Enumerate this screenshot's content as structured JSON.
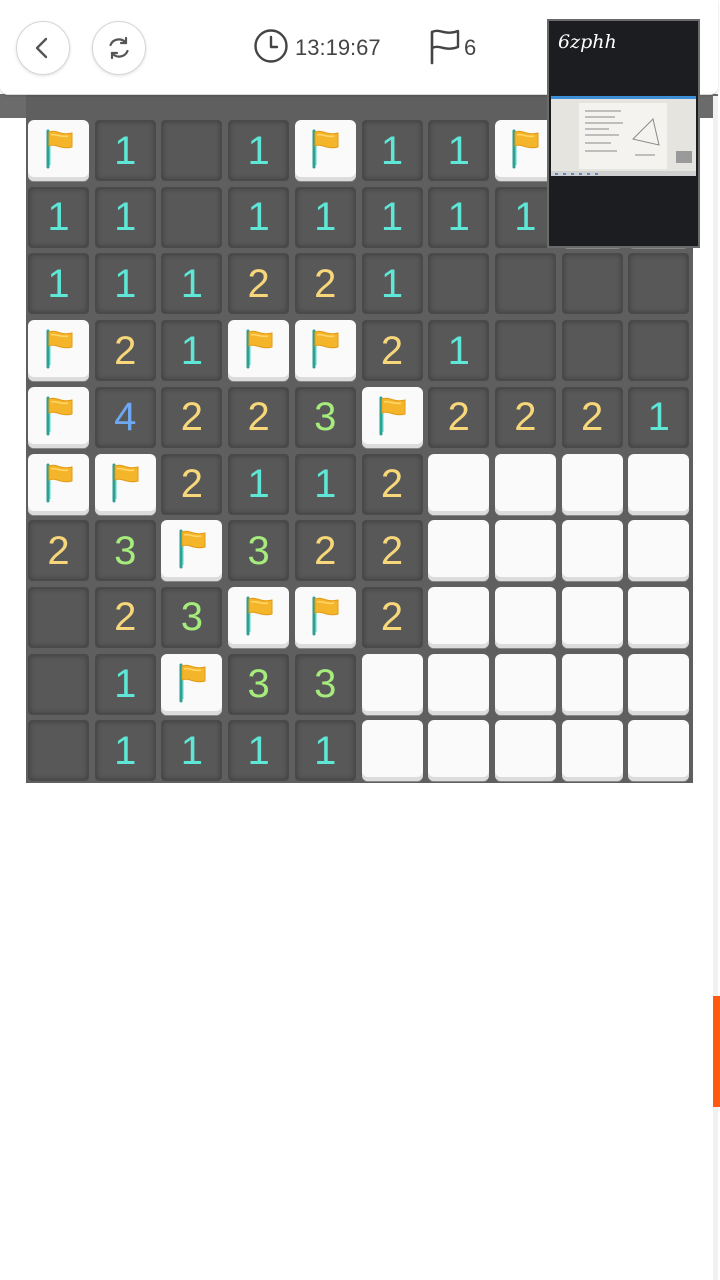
{
  "toolbar": {
    "back_icon": "chevron-left-icon",
    "restart_icon": "refresh-icon",
    "timer": "13:19:67",
    "flags": "6"
  },
  "pip": {
    "label": "6zphh"
  },
  "colors": {
    "number_1": "#5ee6d6",
    "number_2": "#f7d77a",
    "number_3": "#a6ec7c",
    "number_4": "#6ea8f0",
    "flag": "#f5b52a",
    "scroll_thumb": "#ff5a0f"
  },
  "board": {
    "rows": [
      [
        "F",
        "1",
        "",
        "1",
        "F",
        "1",
        "1",
        "F",
        "#",
        "#"
      ],
      [
        "1",
        "1",
        "",
        "1",
        "1",
        "1",
        "1",
        "1",
        "#",
        "#"
      ],
      [
        "1",
        "1",
        "1",
        "2",
        "2",
        "1",
        "",
        "",
        "",
        ""
      ],
      [
        "F",
        "2",
        "1",
        "F",
        "F",
        "2",
        "1",
        "",
        "",
        ""
      ],
      [
        "F",
        "4",
        "2",
        "2",
        "3",
        "F",
        "2",
        "2",
        "2",
        "1"
      ],
      [
        "F",
        "F",
        "2",
        "1",
        "1",
        "2",
        "#",
        "#",
        "#",
        "#"
      ],
      [
        "2",
        "3",
        "F",
        "3",
        "2",
        "2",
        "#",
        "#",
        "#",
        "#"
      ],
      [
        "",
        "2",
        "3",
        "F",
        "F",
        "2",
        "#",
        "#",
        "#",
        "#"
      ],
      [
        "",
        "1",
        "F",
        "3",
        "3",
        "#",
        "#",
        "#",
        "#",
        "#"
      ],
      [
        "",
        "1",
        "1",
        "1",
        "1",
        "#",
        "#",
        "#",
        "#",
        "#"
      ]
    ]
  }
}
